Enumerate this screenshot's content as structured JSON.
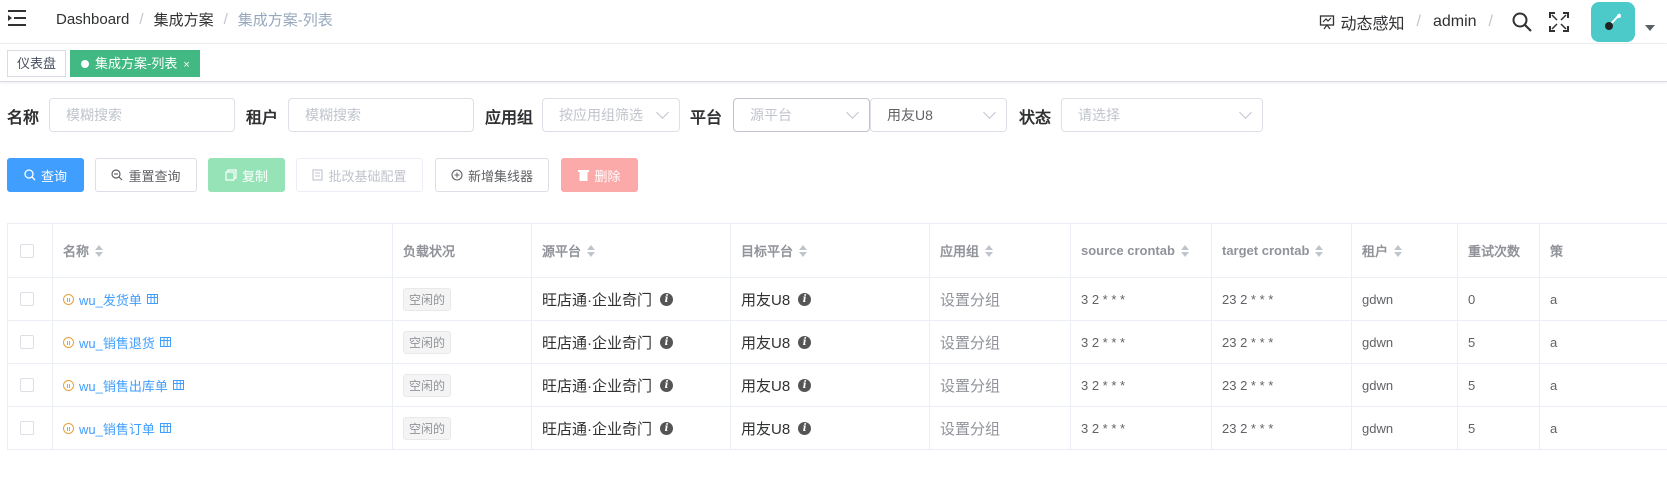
{
  "breadcrumb": [
    "Dashboard",
    "集成方案",
    "集成方案-列表"
  ],
  "nav": {
    "perception": "动态感知",
    "user": "admin"
  },
  "tags": {
    "dashboard": "仪表盘",
    "active": "集成方案-列表",
    "close": "×"
  },
  "filters": {
    "name_label": "名称",
    "name_placeholder": "模糊搜索",
    "tenant_label": "租户",
    "tenant_placeholder": "模糊搜索",
    "group_label": "应用组",
    "group_placeholder": "按应用组筛选",
    "platform_label": "平台",
    "source_placeholder": "源平台",
    "target_value": "用友U8",
    "status_label": "状态",
    "status_placeholder": "请选择"
  },
  "buttons": {
    "query": "查询",
    "reset": "重置查询",
    "copy": "复制",
    "batch": "批改基础配置",
    "add": "新增集线器",
    "delete": "删除"
  },
  "table": {
    "headers": [
      "名称",
      "负载状况",
      "源平台",
      "目标平台",
      "应用组",
      "source crontab",
      "target crontab",
      "租户",
      "重试次数",
      "策"
    ],
    "rows": [
      {
        "name": "wu_发货单",
        "status": "空闲的",
        "source": "旺店通·企业奇门",
        "target": "用友U8",
        "group": "设置分组",
        "src_cron": "3 2 * * *",
        "tgt_cron": "23 2 * * *",
        "tenant": "gdwn",
        "retries": "0",
        "more": "a"
      },
      {
        "name": "wu_销售退货",
        "status": "空闲的",
        "source": "旺店通·企业奇门",
        "target": "用友U8",
        "group": "设置分组",
        "src_cron": "3 2 * * *",
        "tgt_cron": "23 2 * * *",
        "tenant": "gdwn",
        "retries": "5",
        "more": "a"
      },
      {
        "name": "wu_销售出库单",
        "status": "空闲的",
        "source": "旺店通·企业奇门",
        "target": "用友U8",
        "group": "设置分组",
        "src_cron": "3 2 * * *",
        "tgt_cron": "23 2 * * *",
        "tenant": "gdwn",
        "retries": "5",
        "more": "a"
      },
      {
        "name": "wu_销售订单",
        "status": "空闲的",
        "source": "旺店通·企业奇门",
        "target": "用友U8",
        "group": "设置分组",
        "src_cron": "3 2 * * *",
        "tgt_cron": "23 2 * * *",
        "tenant": "gdwn",
        "retries": "5",
        "more": "a"
      }
    ]
  }
}
